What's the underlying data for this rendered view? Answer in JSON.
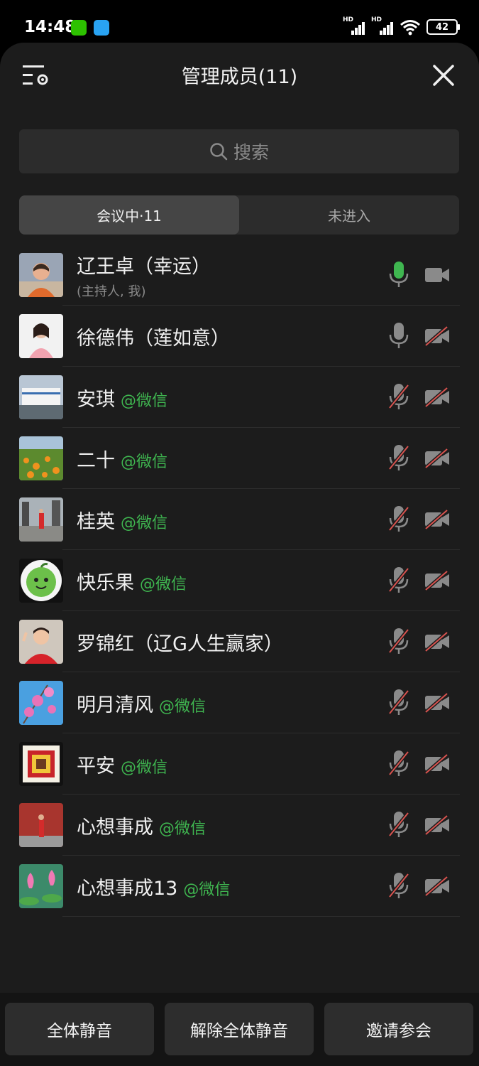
{
  "status_bar": {
    "time": "14:48",
    "signal_label": "HD",
    "battery": "42"
  },
  "header": {
    "title": "管理成员(11)"
  },
  "search": {
    "placeholder": "搜索"
  },
  "tabs": [
    {
      "label": "会议中·11"
    },
    {
      "label": "未进入"
    }
  ],
  "members": [
    {
      "name": "辽王卓（幸运）",
      "tag": "",
      "sub": "(主持人, 我)",
      "mic": "active",
      "cam": "off-gray"
    },
    {
      "name": "徐德伟（莲如意）",
      "tag": "",
      "sub": "",
      "mic": "on",
      "cam": "off"
    },
    {
      "name": "安琪",
      "tag": "@微信",
      "sub": "",
      "mic": "off",
      "cam": "off"
    },
    {
      "name": "二十",
      "tag": "@微信",
      "sub": "",
      "mic": "off",
      "cam": "off"
    },
    {
      "name": "桂英",
      "tag": "@微信",
      "sub": "",
      "mic": "off",
      "cam": "off"
    },
    {
      "name": "快乐果",
      "tag": "@微信",
      "sub": "",
      "mic": "off",
      "cam": "off"
    },
    {
      "name": "罗锦红（辽G人生赢家）",
      "tag": "",
      "sub": "",
      "mic": "off",
      "cam": "off"
    },
    {
      "name": "明月清风",
      "tag": "@微信",
      "sub": "",
      "mic": "off",
      "cam": "off"
    },
    {
      "name": "平安",
      "tag": "@微信",
      "sub": "",
      "mic": "off",
      "cam": "off"
    },
    {
      "name": "心想事成",
      "tag": "@微信",
      "sub": "",
      "mic": "off",
      "cam": "off"
    },
    {
      "name": "心想事成13",
      "tag": "@微信",
      "sub": "",
      "mic": "off",
      "cam": "off"
    }
  ],
  "actions": {
    "mute_all": "全体静音",
    "unmute_all": "解除全体静音",
    "invite": "邀请参会"
  },
  "colors": {
    "accent_green": "#3fb650",
    "mic_active": "#3fb650",
    "mute_slash": "#d9534f"
  }
}
